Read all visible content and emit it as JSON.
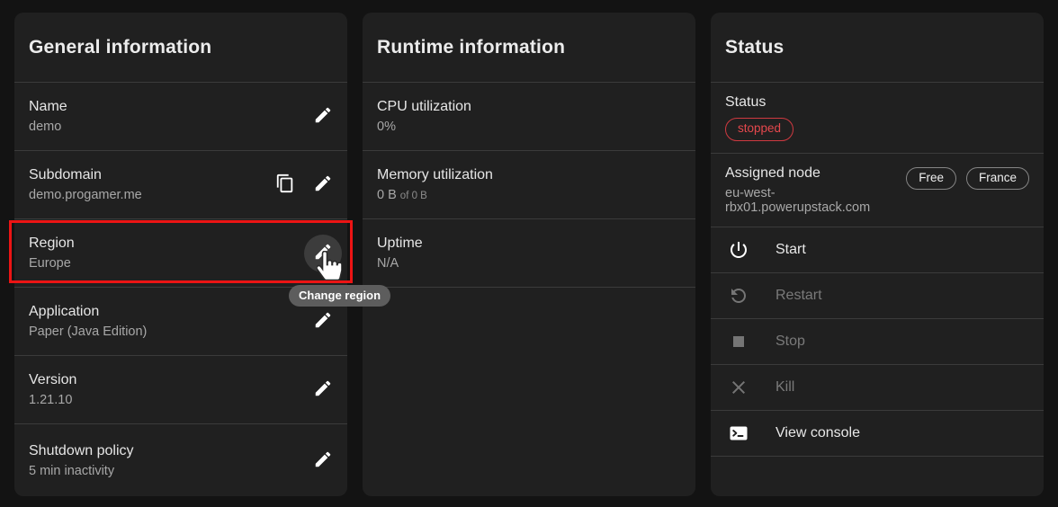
{
  "colors": {
    "page_bg": "#131313",
    "card_bg": "#202020",
    "accent_red": "#e5484d",
    "annotation_red": "#ec1414",
    "tooltip_bg": "#5d5d5d"
  },
  "cards": {
    "general": {
      "title": "General information",
      "rows": [
        {
          "label": "Name",
          "value": "demo"
        },
        {
          "label": "Subdomain",
          "value": "demo.progamer.me"
        },
        {
          "label": "Region",
          "value": "Europe"
        },
        {
          "label": "Application",
          "value": "Paper (Java Edition)"
        },
        {
          "label": "Version",
          "value": "1.21.10"
        },
        {
          "label": "Shutdown policy",
          "value": "5 min inactivity"
        }
      ]
    },
    "runtime": {
      "title": "Runtime information",
      "rows": [
        {
          "label": "CPU utilization",
          "value": "0%"
        },
        {
          "label": "Memory utilization",
          "value": "0 B",
          "suffix": "of 0 B"
        },
        {
          "label": "Uptime",
          "value": "N/A"
        }
      ]
    },
    "status": {
      "title": "Status",
      "status_label": "Status",
      "status_badge": "stopped",
      "node_label": "Assigned node",
      "node_value": "eu-west-rbx01.powerupstack.com",
      "node_badges": [
        "Free",
        "France"
      ],
      "actions": [
        {
          "label": "Start"
        },
        {
          "label": "Restart"
        },
        {
          "label": "Stop"
        },
        {
          "label": "Kill"
        },
        {
          "label": "View console"
        }
      ]
    }
  },
  "tooltip": {
    "text": "Change region"
  }
}
